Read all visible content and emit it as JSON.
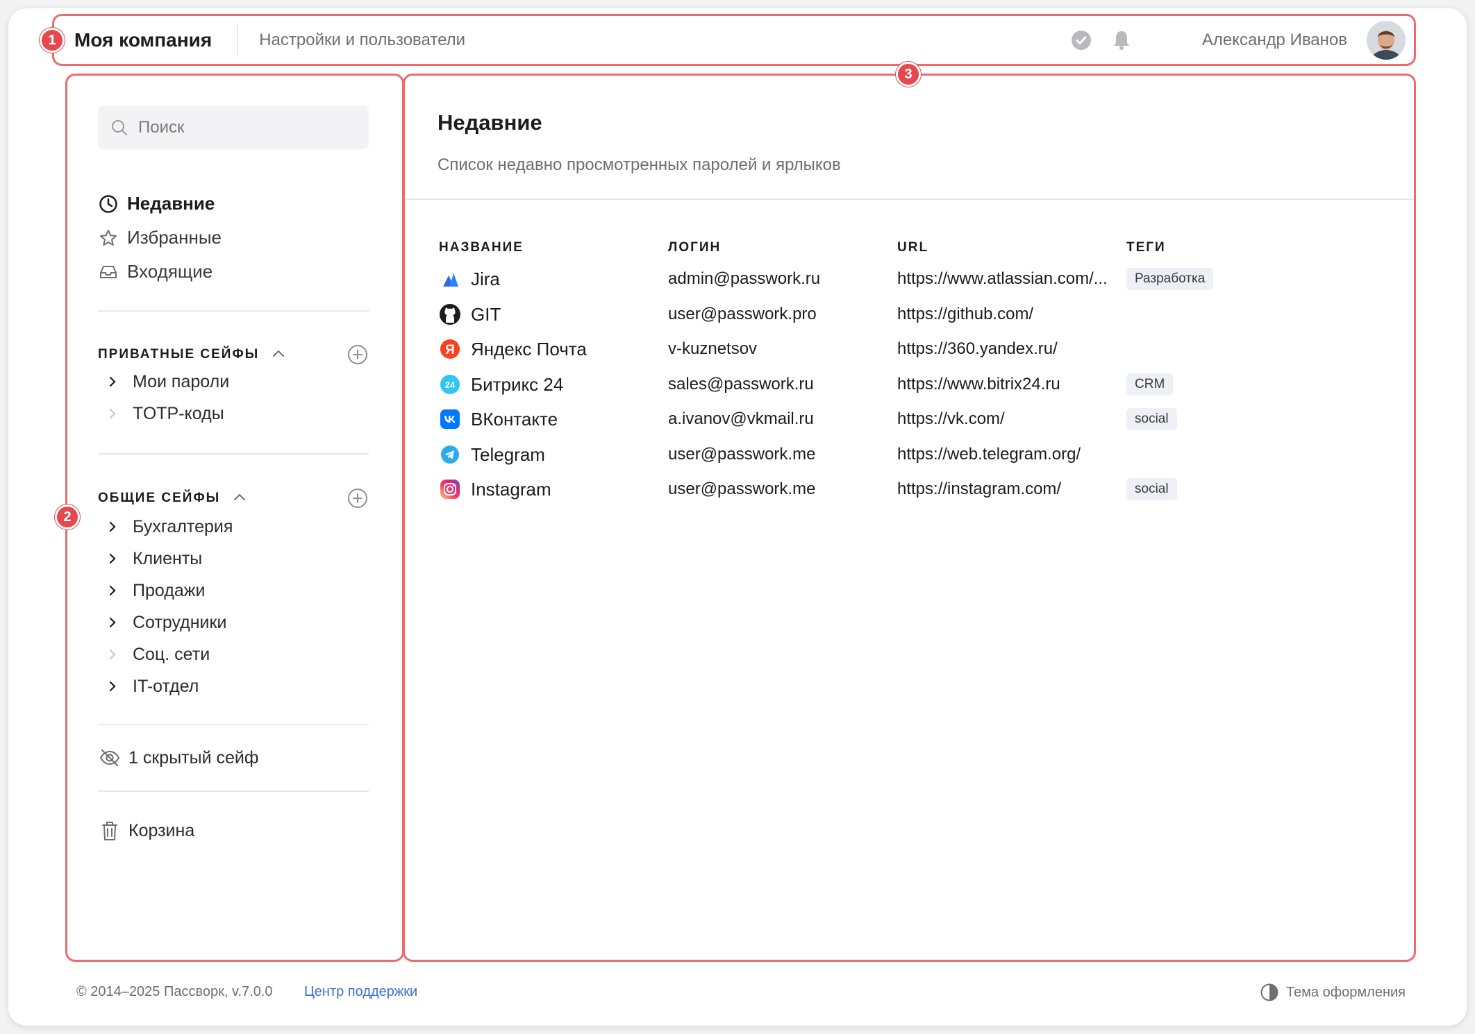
{
  "header": {
    "company": "Моя компания",
    "settings_link": "Настройки и пользователи",
    "user_name": "Александр Иванов"
  },
  "markers": [
    "1",
    "2",
    "3"
  ],
  "sidebar": {
    "search_placeholder": "Поиск",
    "nav": [
      {
        "label": "Недавние",
        "icon": "clock-icon",
        "active": true
      },
      {
        "label": "Избранные",
        "icon": "star-icon",
        "active": false
      },
      {
        "label": "Входящие",
        "icon": "inbox-icon",
        "active": false
      }
    ],
    "private_section": {
      "title": "ПРИВАТНЫЕ СЕЙФЫ",
      "items": [
        "Мои пароли",
        "TOTP-коды"
      ]
    },
    "shared_section": {
      "title": "ОБЩИЕ СЕЙФЫ",
      "items": [
        "Бухгалтерия",
        "Клиенты",
        "Продажи",
        "Сотрудники",
        "Соц. сети",
        "IT-отдел"
      ]
    },
    "hidden_vaults": "1 скрытый сейф",
    "trash": "Корзина"
  },
  "main": {
    "title": "Недавние",
    "subtitle": "Список недавно просмотренных паролей и ярлыков",
    "columns": [
      "НАЗВАНИЕ",
      "ЛОГИН",
      "URL",
      "ТЕГИ"
    ],
    "rows": [
      {
        "name": "Jira",
        "icon": "jira-icon",
        "login": "admin@passwork.ru",
        "url": "https://www.atlassian.com/...",
        "tag": "Разработка"
      },
      {
        "name": "GIT",
        "icon": "github-icon",
        "login": "user@passwork.pro",
        "url": "https://github.com/",
        "tag": ""
      },
      {
        "name": "Яндекс Почта",
        "icon": "yandex-icon",
        "login": "v-kuznetsov",
        "url": "https://360.yandex.ru/",
        "tag": ""
      },
      {
        "name": "Битрикс 24",
        "icon": "bitrix-icon",
        "login": "sales@passwork.ru",
        "url": "https://www.bitrix24.ru",
        "tag": "CRM"
      },
      {
        "name": "ВКонтакте",
        "icon": "vk-icon",
        "login": "a.ivanov@vkmail.ru",
        "url": "https://vk.com/",
        "tag": "social"
      },
      {
        "name": "Telegram",
        "icon": "telegram-icon",
        "login": "user@passwork.me",
        "url": "https://web.telegram.org/",
        "tag": ""
      },
      {
        "name": "Instagram",
        "icon": "instagram-icon",
        "login": "user@passwork.me",
        "url": "https://instagram.com/",
        "tag": "social"
      }
    ]
  },
  "footer": {
    "copyright": "© 2014–2025 Пассворк, v.7.0.0",
    "support": "Центр поддержки",
    "theme": "Тема оформления"
  },
  "colors": {
    "accent": "#ef6b6b",
    "marker": "#e5484d",
    "link": "#3a6fd8"
  }
}
